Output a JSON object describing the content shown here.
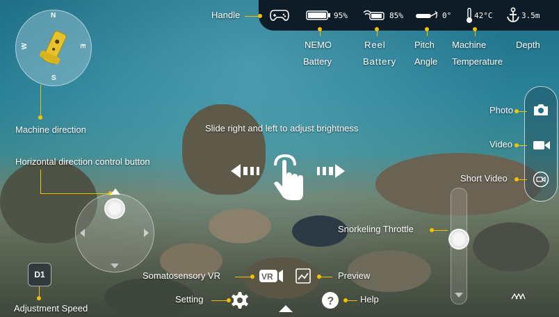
{
  "top_bar": {
    "handle_label": "Handle",
    "nemo_battery": "95%",
    "reel_battery": "85%",
    "pitch": "0°",
    "temperature": "42°C",
    "depth": "3.5m"
  },
  "callouts": {
    "nemo_battery_line1": "NEMO",
    "nemo_battery_line2": "Battery",
    "reel_battery_line1": "Reel",
    "reel_battery_line2": "Battery",
    "pitch_line1": "Pitch",
    "pitch_line2": "Angle",
    "machine_temp_line1": "Machine",
    "machine_temp_line2": "Temperature",
    "depth": "Depth",
    "machine_direction": "Machine direction",
    "brightness_hint": "Slide right and left to adjust brightness",
    "horizontal_control": "Horizontal direction control button",
    "photo": "Photo",
    "video": "Video",
    "short_video": "Short Video",
    "snorkeling_throttle": "Snorkeling Throttle",
    "somatosensory_vr": "Somatosensory VR",
    "preview": "Preview",
    "setting": "Setting",
    "help": "Help",
    "adjustment_speed": "Adjustment Speed"
  },
  "compass": {
    "n": "N",
    "s": "S",
    "e": "E",
    "w": "W"
  },
  "speed_button": "D1",
  "icons": {
    "handle": "gamepad-icon",
    "nemo_battery": "battery-icon",
    "reel_battery": "reel-battery-icon",
    "pitch": "pitch-icon",
    "temperature": "thermometer-icon",
    "depth": "anchor-icon",
    "photo": "camera-icon",
    "video": "video-camera-icon",
    "short_video": "short-video-icon",
    "vr": "vr-icon",
    "preview": "preview-icon",
    "setting": "gear-icon",
    "help": "help-icon",
    "expand": "chevron-up-icon",
    "brightness": "swipe-hand-icon"
  },
  "colors": {
    "accent": "#f2c200",
    "topbar": "#0d1c26"
  }
}
